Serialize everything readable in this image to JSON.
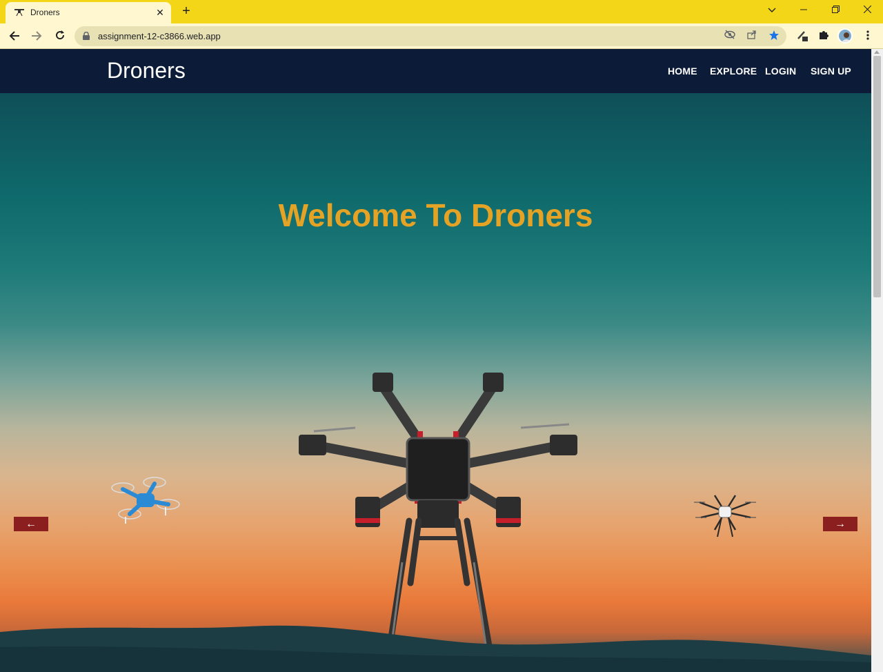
{
  "browser": {
    "tab_title": "Droners",
    "url": "assignment-12-c3866.web.app",
    "new_tab_symbol": "+",
    "close_symbol": "✕",
    "icons": [
      "back-icon",
      "forward-icon",
      "reload-icon",
      "lock-icon",
      "eye-off-icon",
      "share-icon",
      "star-icon",
      "extension-icon",
      "puzzle-icon",
      "menu-icon"
    ]
  },
  "site": {
    "brand": "Droners",
    "nav": [
      {
        "label": "HOME"
      },
      {
        "label": "EXPLORE"
      },
      {
        "label": "LOGIN"
      },
      {
        "label": "SIGN UP"
      }
    ]
  },
  "hero": {
    "title": "Welcome To Droners",
    "title_color": "#e4a325",
    "prev_symbol": "←",
    "next_symbol": "→"
  },
  "colors": {
    "tab_strip": "#f3d617",
    "navbar": "#0c1b37",
    "arrow_button": "#8b1e1e"
  }
}
